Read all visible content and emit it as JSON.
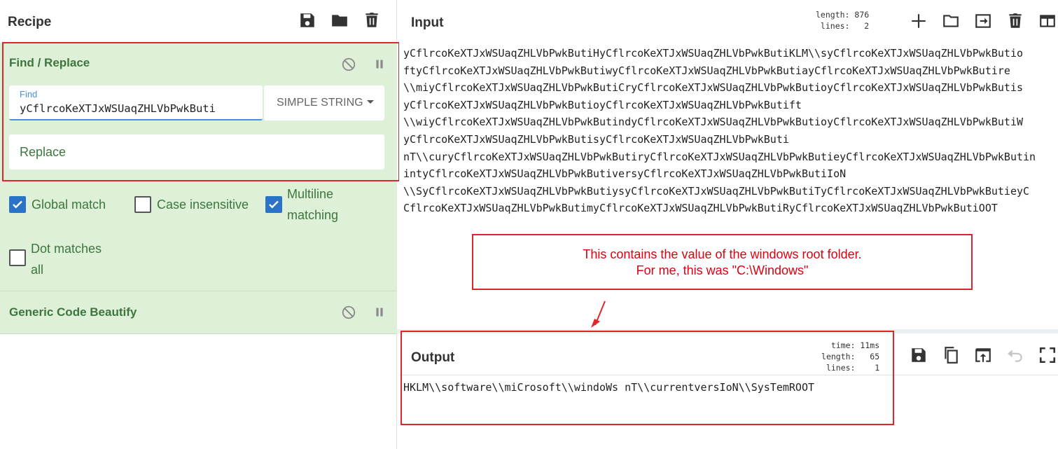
{
  "recipe": {
    "title": "Recipe",
    "icons": [
      "save-icon",
      "folder-icon",
      "trash-icon"
    ],
    "operations": [
      {
        "name": "Find / Replace",
        "find_label": "Find",
        "find_value": "yCflrcoKeXTJxWSUaqZHLVbPwkButi",
        "search_type": "SIMPLE STRING",
        "replace_placeholder": "Replace",
        "options": [
          {
            "label": "Global match",
            "checked": true
          },
          {
            "label": "Case insensitive",
            "checked": false
          },
          {
            "label": "Multiline matching",
            "label_lines": [
              "Multiline",
              "matching"
            ],
            "checked": true
          },
          {
            "label": "Dot matches all",
            "label_lines": [
              "Dot matches",
              "all"
            ],
            "checked": false
          }
        ]
      },
      {
        "name": "Generic Code Beautify"
      }
    ]
  },
  "input": {
    "title": "Input",
    "stats": {
      "length_label": "length:",
      "length": "876",
      "lines_label": "lines:",
      "lines": "2"
    },
    "lines": [
      "yCflrcoKeXTJxWSUaqZHLVbPwkButiHyCflrcoKeXTJxWSUaqZHLVbPwkButiKLM\\\\syCflrcoKeXTJxWSUaqZHLVbPwkButio",
      "ftyCflrcoKeXTJxWSUaqZHLVbPwkButiwyCflrcoKeXTJxWSUaqZHLVbPwkButiayCflrcoKeXTJxWSUaqZHLVbPwkButire",
      "\\\\miyCflrcoKeXTJxWSUaqZHLVbPwkButiCryCflrcoKeXTJxWSUaqZHLVbPwkButioyCflrcoKeXTJxWSUaqZHLVbPwkButis",
      "yCflrcoKeXTJxWSUaqZHLVbPwkButioyCflrcoKeXTJxWSUaqZHLVbPwkButift",
      "\\\\wiyCflrcoKeXTJxWSUaqZHLVbPwkButindyCflrcoKeXTJxWSUaqZHLVbPwkButioyCflrcoKeXTJxWSUaqZHLVbPwkButiW",
      "yCflrcoKeXTJxWSUaqZHLVbPwkButisyCflrcoKeXTJxWSUaqZHLVbPwkButi",
      "nT\\\\curyCflrcoKeXTJxWSUaqZHLVbPwkButiryCflrcoKeXTJxWSUaqZHLVbPwkButieyCflrcoKeXTJxWSUaqZHLVbPwkButin",
      "intyCflrcoKeXTJxWSUaqZHLVbPwkButiversyCflrcoKeXTJxWSUaqZHLVbPwkButiIoN",
      "\\\\SyCflrcoKeXTJxWSUaqZHLVbPwkButiysyCflrcoKeXTJxWSUaqZHLVbPwkButiTyCflrcoKeXTJxWSUaqZHLVbPwkButieyC",
      "CflrcoKeXTJxWSUaqZHLVbPwkButimyCflrcoKeXTJxWSUaqZHLVbPwkButiRyCflrcoKeXTJxWSUaqZHLVbPwkButiOOT"
    ],
    "icons": [
      "plus-icon",
      "folder-icon",
      "import-icon",
      "trash-icon",
      "layout-icon"
    ]
  },
  "annotation": {
    "line1": "This contains the value of the windows root folder.",
    "line2": "For me, this was \"C:\\Windows\""
  },
  "output": {
    "title": "Output",
    "stats": {
      "time_label": "time:",
      "time": "11ms",
      "length_label": "length:",
      "length": "65",
      "lines_label": "lines:",
      "lines": "1"
    },
    "text": "HKLM\\\\software\\\\miCrosoft\\\\windoWs nT\\\\currentversIoN\\\\SysTemROOT",
    "icons": [
      "save-icon",
      "copy-icon",
      "open-in-input-icon",
      "undo-icon",
      "maximize-icon"
    ]
  },
  "colors": {
    "op_bg": "#dff0d8",
    "op_text": "#3c763d",
    "checkbox_on": "#2a73c9",
    "highlight_red": "#e0252c",
    "annotation_text": "#e0000f"
  }
}
